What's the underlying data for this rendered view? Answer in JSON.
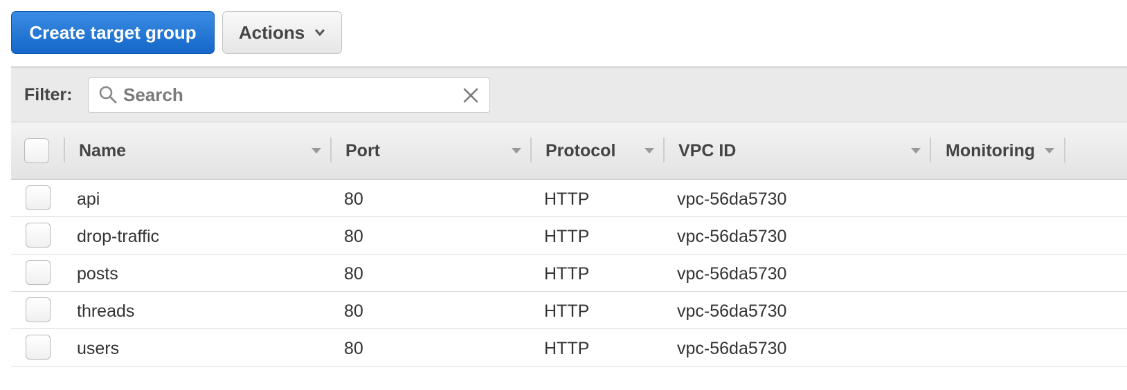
{
  "toolbar": {
    "create_label": "Create target group",
    "actions_label": "Actions"
  },
  "filter": {
    "label": "Filter:",
    "placeholder": "Search",
    "value": ""
  },
  "table": {
    "columns": [
      "Name",
      "Port",
      "Protocol",
      "VPC ID",
      "Monitoring"
    ],
    "rows": [
      {
        "name": "api",
        "port": "80",
        "protocol": "HTTP",
        "vpc_id": "vpc-56da5730",
        "monitoring": ""
      },
      {
        "name": "drop-traffic",
        "port": "80",
        "protocol": "HTTP",
        "vpc_id": "vpc-56da5730",
        "monitoring": ""
      },
      {
        "name": "posts",
        "port": "80",
        "protocol": "HTTP",
        "vpc_id": "vpc-56da5730",
        "monitoring": ""
      },
      {
        "name": "threads",
        "port": "80",
        "protocol": "HTTP",
        "vpc_id": "vpc-56da5730",
        "monitoring": ""
      },
      {
        "name": "users",
        "port": "80",
        "protocol": "HTTP",
        "vpc_id": "vpc-56da5730",
        "monitoring": ""
      }
    ]
  },
  "icons": {
    "actions_dropdown": "chevron-down-icon",
    "search": "search-icon",
    "clear": "close-icon",
    "sort": "sort-down-icon"
  },
  "colors": {
    "primary": "#1f72d1",
    "header_bg": "#e8e8e8"
  }
}
